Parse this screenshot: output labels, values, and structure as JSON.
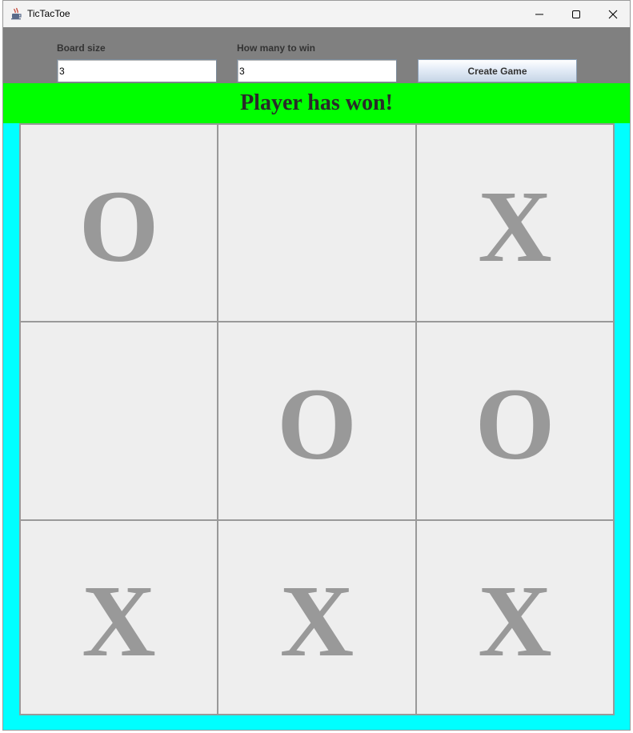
{
  "window": {
    "title": "TicTacToe",
    "icon": "java-cup-icon"
  },
  "controls": {
    "board_size_label": "Board size",
    "board_size_value": "3",
    "win_count_label": "How many to win",
    "win_count_value": "3",
    "create_button_label": "Create Game"
  },
  "status": {
    "text": "Player has won!",
    "color": "#00ff00"
  },
  "board": {
    "background_color": "#00ffff",
    "size": 3,
    "cells": [
      [
        "O",
        "",
        "X"
      ],
      [
        "",
        "O",
        "O"
      ],
      [
        "X",
        "X",
        "X"
      ]
    ]
  }
}
